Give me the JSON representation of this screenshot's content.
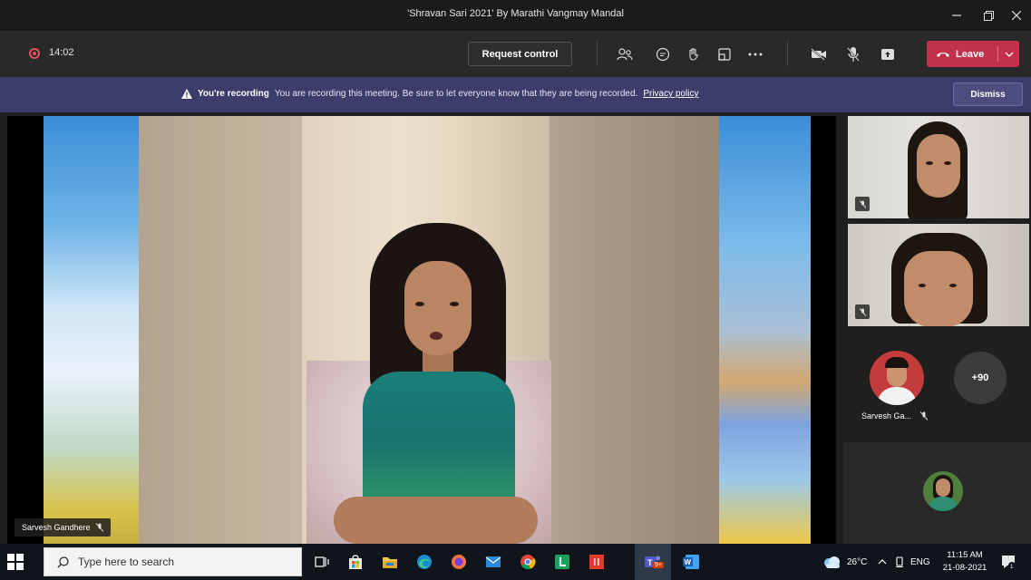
{
  "window": {
    "title": "'Shravan Sari 2021' By Marathi Vangmay Mandal",
    "controls": [
      "minimize-icon",
      "restore-icon",
      "close-icon"
    ]
  },
  "toolbar": {
    "timer": "14:02",
    "request_control_label": "Request control",
    "icons": [
      "participants-icon",
      "chat-icon",
      "reactions-icon",
      "rooms-icon",
      "more-icon",
      "camera-off-icon",
      "mic-off-icon",
      "share-icon"
    ],
    "leave_label": "Leave"
  },
  "banner": {
    "bold_text": "You're recording",
    "message": "You are recording this meeting. Be sure to let everyone know that they are being recorded.",
    "link_text": "Privacy policy",
    "dismiss_label": "Dismiss"
  },
  "stage": {
    "speaker_name": "Sarvesh Gandhere"
  },
  "participants": {
    "avatar_name": "Sarvesh Ga...",
    "overflow_count": "+90"
  },
  "taskbar": {
    "search_placeholder": "Type here to search",
    "apps": [
      "task-view-icon",
      "store-icon",
      "file-explorer-icon",
      "edge-icon",
      "firefox-icon",
      "mail-icon",
      "chrome-icon",
      "lens-icon",
      "office-icon",
      "teams-icon",
      "word-icon"
    ],
    "teams_badge": "9+",
    "weather": "26°C",
    "language": "ENG",
    "time": "11:15 AM",
    "date": "21-08-2021"
  },
  "colors": {
    "leave": "#c4314b",
    "banner": "#3d3d6b",
    "toolbar": "#292929",
    "recording": "#e0525e"
  }
}
